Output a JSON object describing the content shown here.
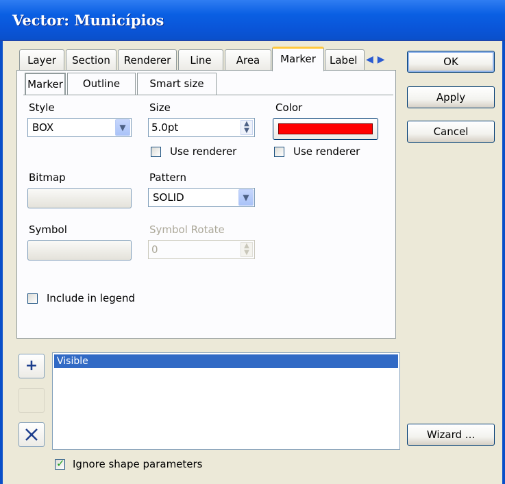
{
  "window": {
    "title": "Vector: Municípios"
  },
  "tabs": [
    {
      "label": "Layer"
    },
    {
      "label": "Section"
    },
    {
      "label": "Renderer"
    },
    {
      "label": "Line"
    },
    {
      "label": "Area"
    },
    {
      "label": "Marker"
    },
    {
      "label": "Label"
    }
  ],
  "active_tab": "Marker",
  "subtabs": [
    {
      "label": "Marker"
    },
    {
      "label": "Outline"
    },
    {
      "label": "Smart size"
    }
  ],
  "marker": {
    "style_label": "Style",
    "style_value": "BOX",
    "size_label": "Size",
    "size_value": "5.0pt",
    "size_use_renderer": "Use renderer",
    "color_label": "Color",
    "color_hex": "#ff0000",
    "color_use_renderer": "Use renderer",
    "bitmap_label": "Bitmap",
    "pattern_label": "Pattern",
    "pattern_value": "SOLID",
    "symbol_label": "Symbol",
    "symbol_rotate_label": "Symbol Rotate",
    "symbol_rotate_value": "0",
    "include_legend": "Include in legend"
  },
  "buttons": {
    "ok": "OK",
    "apply": "Apply",
    "cancel": "Cancel",
    "wizard": "Wizard ..."
  },
  "rules": {
    "items": [
      {
        "label": "Visible",
        "selected": true
      }
    ],
    "add_icon": "plus-icon",
    "remove_icon": "x-icon"
  },
  "ignore_shape": {
    "label": "Ignore shape parameters",
    "checked": true
  }
}
